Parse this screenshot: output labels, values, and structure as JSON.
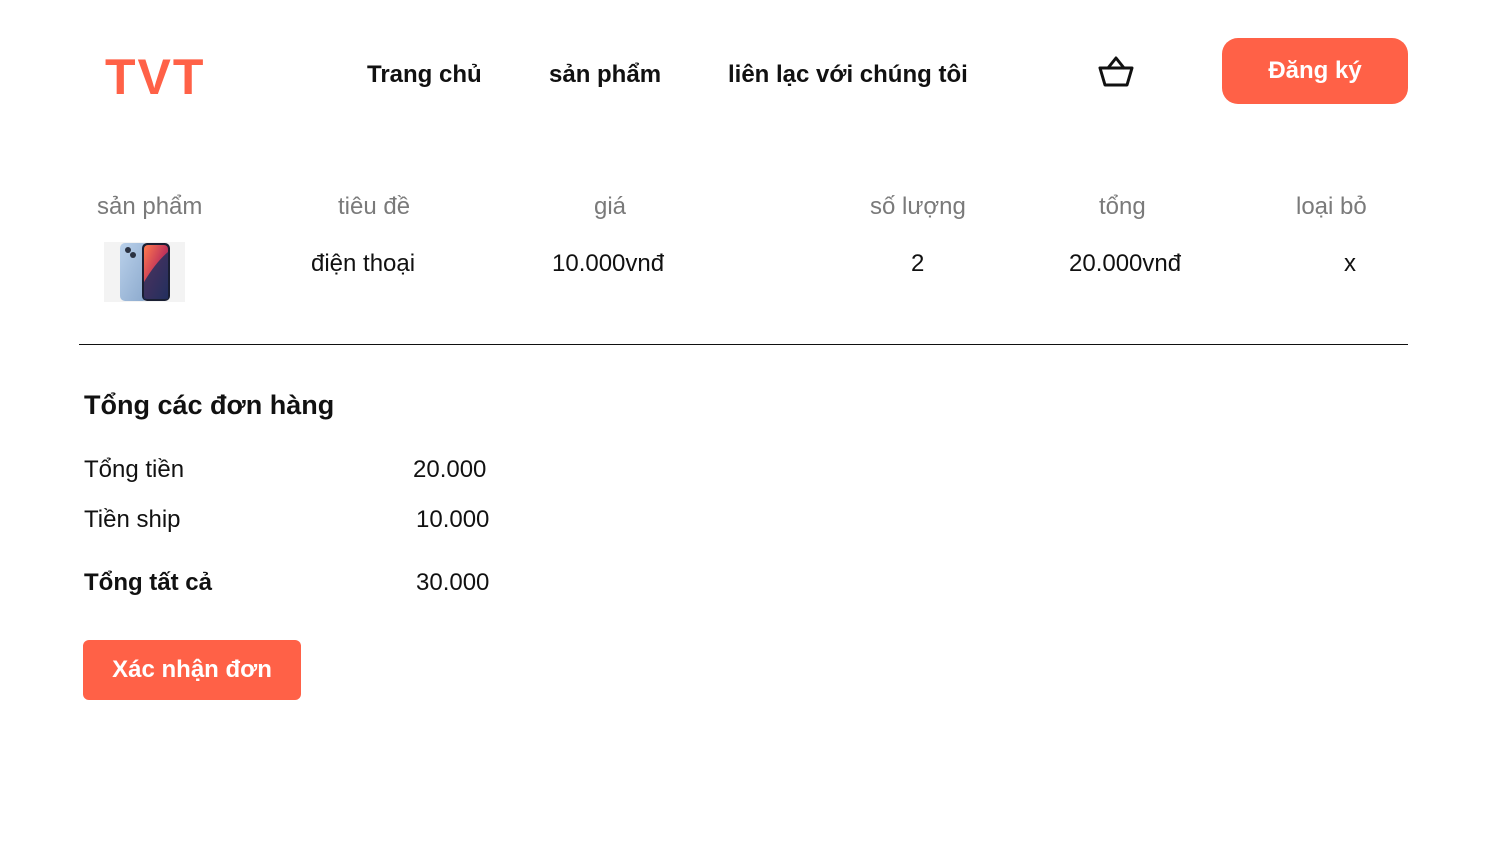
{
  "header": {
    "logo": "TVT",
    "nav": {
      "home": "Trang chủ",
      "products": "sản phẩm",
      "contact": "liên lạc với chúng tôi"
    },
    "cart_icon": "basket-icon",
    "signup_label": "Đăng ký"
  },
  "cart_table": {
    "headers": {
      "product": "sản phẩm",
      "title": "tiêu đề",
      "price": "giá",
      "quantity": "số lượng",
      "total": "tổng",
      "remove": "loại bỏ"
    },
    "rows": [
      {
        "image": "iphone-product-image",
        "title": "điện thoại",
        "price": "10.000vnđ",
        "quantity": "2",
        "total": "20.000vnđ",
        "remove": "x"
      }
    ]
  },
  "summary": {
    "title": "Tổng các đơn hàng",
    "subtotal_label": "Tổng tiền",
    "subtotal_value": "20.000",
    "shipping_label": "Tiền ship",
    "shipping_value": "10.000",
    "grand_total_label": "Tổng tất cả",
    "grand_total_value": "30.000",
    "confirm_label": "Xác nhận đơn"
  },
  "colors": {
    "accent": "#ff6147",
    "text": "#111111",
    "muted": "#7a7a7a"
  }
}
